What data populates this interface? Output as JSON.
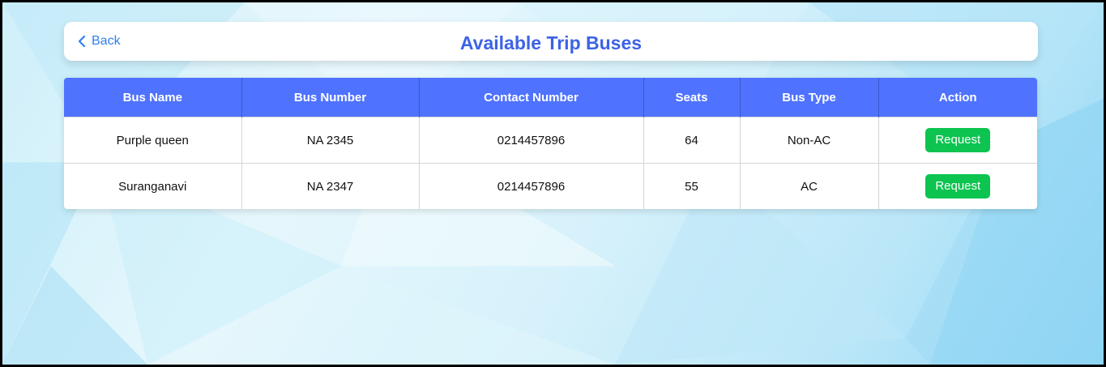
{
  "header": {
    "back_label": "Back",
    "title": "Available Trip Buses"
  },
  "table": {
    "columns": [
      "Bus Name",
      "Bus Number",
      "Contact Number",
      "Seats",
      "Bus Type",
      "Action"
    ],
    "rows": [
      {
        "bus_name": "Purple queen",
        "bus_number": "NA 2345",
        "contact_number": "0214457896",
        "seats": "64",
        "bus_type": "Non-AC",
        "action_label": "Request"
      },
      {
        "bus_name": "Suranganavi",
        "bus_number": "NA 2347",
        "contact_number": "0214457896",
        "seats": "55",
        "bus_type": "AC",
        "action_label": "Request"
      }
    ]
  },
  "colors": {
    "title": "#3d63e6",
    "link": "#2f80ed",
    "table_header_bg": "#4f73ff",
    "request_button_bg": "#0cc44f"
  },
  "icons": {
    "back": "chevron-left-icon"
  }
}
